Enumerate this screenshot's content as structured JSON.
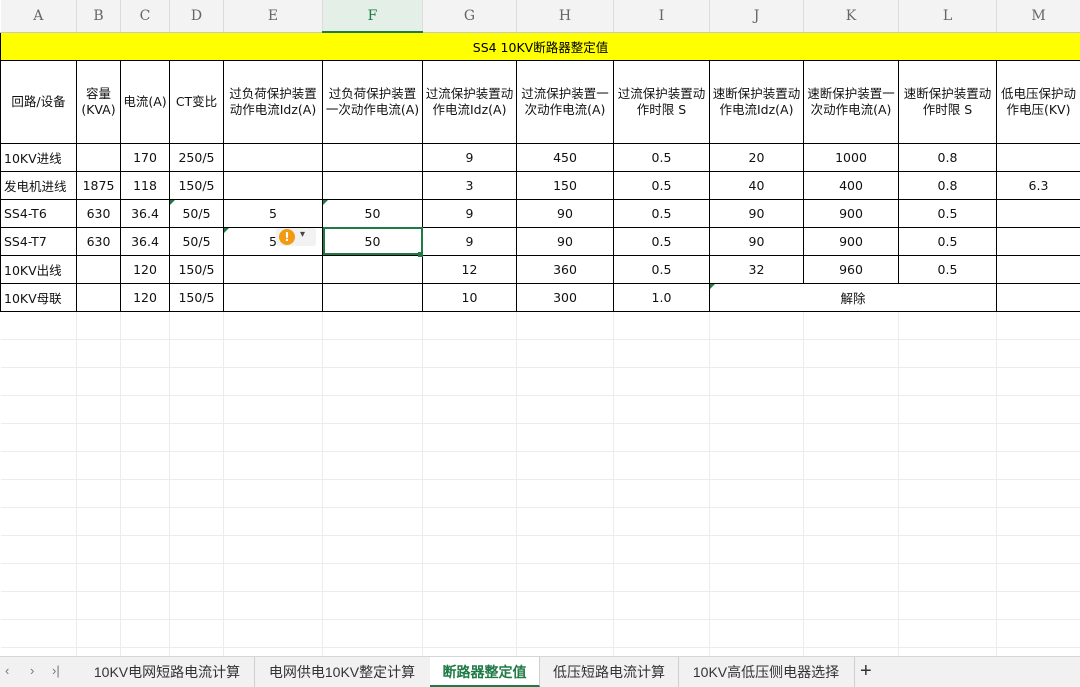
{
  "columns": [
    "A",
    "B",
    "C",
    "D",
    "E",
    "F",
    "G",
    "H",
    "I",
    "J",
    "K",
    "L",
    "M"
  ],
  "title": "SS4 10KV断路器整定值",
  "headers": {
    "a": "回路/设备",
    "b": "容量(KVA)",
    "c": "电流(A)",
    "d": "CT变比",
    "e": "过负荷保护装置动作电流Idz(A)",
    "f": "过负荷保护装置一次动作电流(A)",
    "g": "过流保护装置动作电流Idz(A)",
    "h": "过流保护装置一次动作电流(A)",
    "i": "过流保护装置动作时限 S",
    "j": "速断保护装置动作电流Idz(A)",
    "k": "速断保护装置一次动作电流(A)",
    "l": "速断保护装置动作时限 S",
    "m": "低电压保护动作电压(KV)"
  },
  "rows": [
    {
      "a": "10KV进线",
      "b": "",
      "c": "170",
      "d": "250/5",
      "e": "",
      "f": "",
      "g": "9",
      "h": "450",
      "i": "0.5",
      "j": "20",
      "k": "1000",
      "l": "0.8",
      "m": ""
    },
    {
      "a": "发电机进线",
      "b": "1875",
      "c": "118",
      "d": "150/5",
      "e": "",
      "f": "",
      "g": "3",
      "h": "150",
      "i": "0.5",
      "j": "40",
      "k": "400",
      "l": "0.8",
      "m": "6.3"
    },
    {
      "a": "SS4-T6",
      "b": "630",
      "c": "36.4",
      "d": "50/5",
      "e": "5",
      "f": "50",
      "g": "9",
      "h": "90",
      "i": "0.5",
      "j": "90",
      "k": "900",
      "l": "0.5",
      "m": ""
    },
    {
      "a": "SS4-T7",
      "b": "630",
      "c": "36.4",
      "d": "50/5",
      "e": "5",
      "f": "50",
      "g": "9",
      "h": "90",
      "i": "0.5",
      "j": "90",
      "k": "900",
      "l": "0.5",
      "m": ""
    },
    {
      "a": "10KV出线",
      "b": "",
      "c": "120",
      "d": "150/5",
      "e": "",
      "f": "",
      "g": "12",
      "h": "360",
      "i": "0.5",
      "j": "32",
      "k": "960",
      "l": "0.5",
      "m": ""
    },
    {
      "a": "10KV母联",
      "b": "",
      "c": "120",
      "d": "150/5",
      "e": "",
      "f": "",
      "g": "10",
      "h": "300",
      "i": "1.0",
      "jkl": "解除",
      "m": ""
    }
  ],
  "sheet_tabs": [
    "10KV电网短路电流计算",
    "电网供电10KV整定计算",
    "断路器整定值",
    "低压短路电流计算",
    "10KV高低压侧电器选择"
  ],
  "active_tab": "断路器整定值",
  "nav": {
    "prev": "‹",
    "next": "›",
    "last": "›|",
    "add": "+"
  },
  "colors": {
    "title_bg": "#ffff00",
    "accent": "#1f7a46",
    "warning": "#f29b12"
  },
  "warning_icon": "exclamation-icon"
}
